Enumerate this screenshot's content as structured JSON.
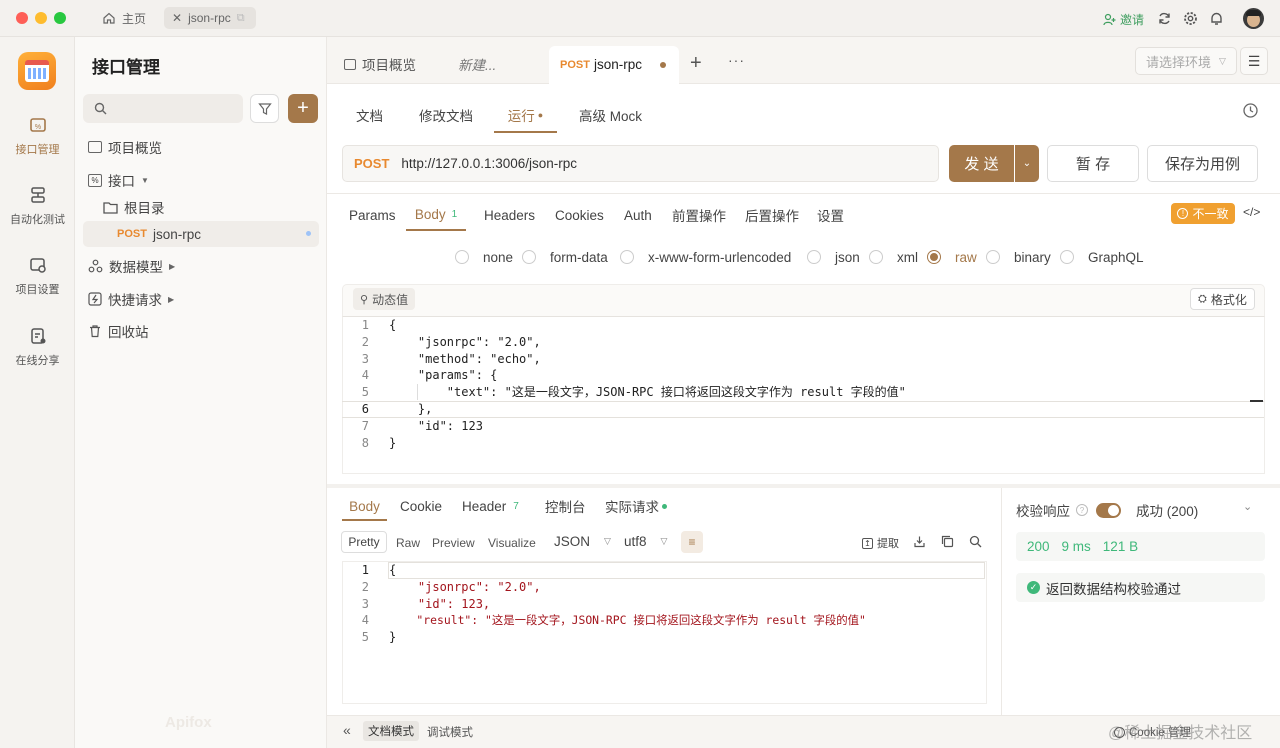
{
  "titlebar": {
    "home_tab": "主页",
    "file_tab": "json-rpc",
    "invite": "邀请"
  },
  "rail": [
    {
      "label": "接口管理",
      "icon": "api-management-icon",
      "active": true
    },
    {
      "label": "自动化测试",
      "icon": "automation-icon",
      "active": false
    },
    {
      "label": "项目设置",
      "icon": "project-settings-icon",
      "active": false
    },
    {
      "label": "在线分享",
      "icon": "share-icon",
      "active": false
    }
  ],
  "sidebar": {
    "title": "接口管理",
    "search_placeholder": "",
    "items": [
      {
        "label": "项目概览",
        "icon": "overview-icon"
      },
      {
        "label": "接口",
        "icon": "api-icon"
      },
      {
        "label": "根目录",
        "icon": "folder-icon"
      },
      {
        "method": "POST",
        "label": "json-rpc"
      },
      {
        "label": "数据模型",
        "icon": "model-icon"
      },
      {
        "label": "快捷请求",
        "icon": "quick-request-icon"
      },
      {
        "label": "回收站",
        "icon": "trash-icon"
      }
    ],
    "brand": "Apifox"
  },
  "page_tabs": {
    "overview": "项目概览",
    "new": "新建...",
    "active_method": "POST",
    "active_name": "json-rpc",
    "env_placeholder": "请选择环境"
  },
  "sub_tabs": [
    "文档",
    "修改文档",
    "运行",
    "高级 Mock"
  ],
  "request": {
    "method": "POST",
    "url": "http://127.0.0.1:3006/json-rpc",
    "send": "发 送",
    "save_draft": "暂 存",
    "save_case": "保存为用例"
  },
  "req_tabs": {
    "params": "Params",
    "body": "Body",
    "body_count": "1",
    "headers": "Headers",
    "cookies": "Cookies",
    "auth": "Auth",
    "pre": "前置操作",
    "post": "后置操作",
    "settings": "设置",
    "mismatch": "不一致"
  },
  "body_types": [
    "none",
    "form-data",
    "x-www-form-urlencoded",
    "json",
    "xml",
    "raw",
    "binary",
    "GraphQL"
  ],
  "body_selected": "raw",
  "dynamic_value": "动态值",
  "format_btn": "格式化",
  "request_body_lines": [
    "{",
    "    \"jsonrpc\": \"2.0\",",
    "    \"method\": \"echo\",",
    "    \"params\": {",
    "        \"text\": \"这是一段文字，JSON-RPC 接口将返回这段文字作为 result 字段的值\"",
    "    },",
    "    \"id\": 123",
    "}"
  ],
  "line_numbers": [
    "1",
    "2",
    "3",
    "4",
    "5",
    "6",
    "7",
    "8"
  ],
  "resp_tabs": {
    "body": "Body",
    "cookie": "Cookie",
    "header": "Header",
    "header_count": "7",
    "console": "控制台",
    "actual": "实际请求"
  },
  "resp_toolbar": {
    "pretty": "Pretty",
    "raw": "Raw",
    "preview": "Preview",
    "visualize": "Visualize",
    "format": "JSON",
    "encoding": "utf8",
    "extract": "提取"
  },
  "response_lines": [
    "{",
    "    \"jsonrpc\": \"2.0\",",
    "    \"id\": 123,",
    "    \"result\": \"这是一段文字，JSON-RPC 接口将返回这段文字作为 result 字段的值\"",
    "}"
  ],
  "resp_line_numbers": [
    "1",
    "2",
    "3",
    "4",
    "5"
  ],
  "validation": {
    "label": "校验响应",
    "status": "成功 (200)",
    "code": "200",
    "time": "9 ms",
    "size": "121 B",
    "message": "返回数据结构校验通过"
  },
  "bottom": {
    "doc_mode": "文档模式",
    "debug_mode": "调试模式",
    "cookie_mgr": "Cookie 管理",
    "watermark": "@稀土掘金技术社区"
  },
  "colors": {
    "accent": "#a4784a",
    "post": "#e8892f",
    "green": "#3fb87a",
    "warn": "#f0a030"
  }
}
